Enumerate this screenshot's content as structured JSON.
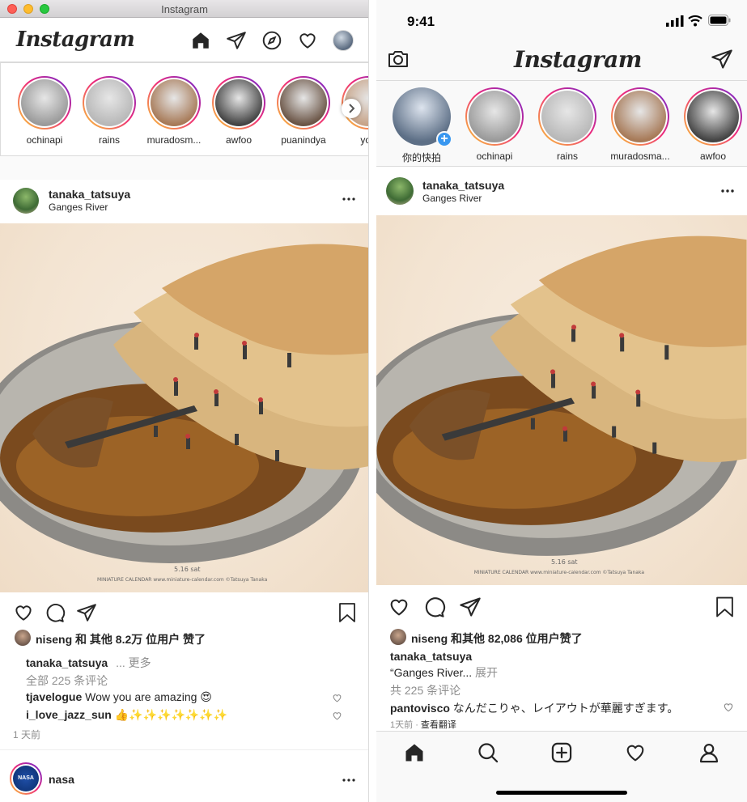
{
  "desktop": {
    "window_title": "Instagram",
    "logo": "Instagram",
    "nav_icons": [
      "home-icon",
      "direct-icon",
      "explore-icon",
      "activity-icon",
      "profile-avatar"
    ],
    "stories": [
      {
        "name": "ochinapi",
        "color": "#9a9a9a"
      },
      {
        "name": "rains",
        "color": "#b8b8b8"
      },
      {
        "name": "muradosm...",
        "color": "#a77a58"
      },
      {
        "name": "awfoo",
        "color": "#444444"
      },
      {
        "name": "puanindya",
        "color": "#6b5546"
      },
      {
        "name": "yori",
        "color": "#c7a489"
      }
    ],
    "post": {
      "username": "tanaka_tatsuya",
      "location": "Ganges River",
      "likes_user": "niseng",
      "likes_text": "和 其他 8.2万 位用户 赞了",
      "caption_user": "tanaka_tatsuya",
      "caption_more": "... 更多",
      "view_comments": "全部 225 条评论",
      "comments": [
        {
          "user": "tjavelogue",
          "text": "Wow you are amazing 😍"
        },
        {
          "user": "i_love_jazz_sun",
          "text": "👍✨✨✨✨✨✨✨"
        }
      ],
      "time": "1 天前"
    },
    "next_post_user": "nasa",
    "image_caption": "5.16 sat",
    "image_credit": "MINIATURE CALENDAR  www.miniature-calendar.com  ©Tatsuya Tanaka"
  },
  "phone": {
    "time": "9:41",
    "logo": "Instagram",
    "stories": [
      {
        "name": "你的快拍",
        "color": "#5d6f86",
        "own": true
      },
      {
        "name": "ochinapi",
        "color": "#9a9a9a"
      },
      {
        "name": "rains",
        "color": "#b8b8b8"
      },
      {
        "name": "muradosma...",
        "color": "#a77a58"
      },
      {
        "name": "awfoo",
        "color": "#444444"
      }
    ],
    "post": {
      "username": "tanaka_tatsuya",
      "location": "Ganges River",
      "likes_user": "niseng",
      "likes_text": "和其他 82,086 位用户赞了",
      "caption_user": "tanaka_tatsuya",
      "caption_text": "“Ganges River...",
      "caption_more": "展开",
      "view_comments": "共 225 条评论",
      "comment_user": "pantovisco",
      "comment_text": "なんだこりゃ、レイアウトが華麗すぎます。",
      "time": "1天前",
      "translate": "查看翻译"
    },
    "tabs": [
      "home-icon",
      "search-icon",
      "new-post-icon",
      "activity-icon",
      "profile-icon"
    ]
  },
  "colors": {
    "story_ring_start": "#f9ce34",
    "story_ring_mid": "#ee2a7b",
    "story_ring_end": "#6228d7",
    "text": "#262626",
    "muted": "#8e8e8e",
    "border": "#dbdbdb",
    "close": "#fe5f57",
    "minimize": "#febc2e",
    "zoom": "#28c840",
    "add_story": "#3897f0"
  }
}
